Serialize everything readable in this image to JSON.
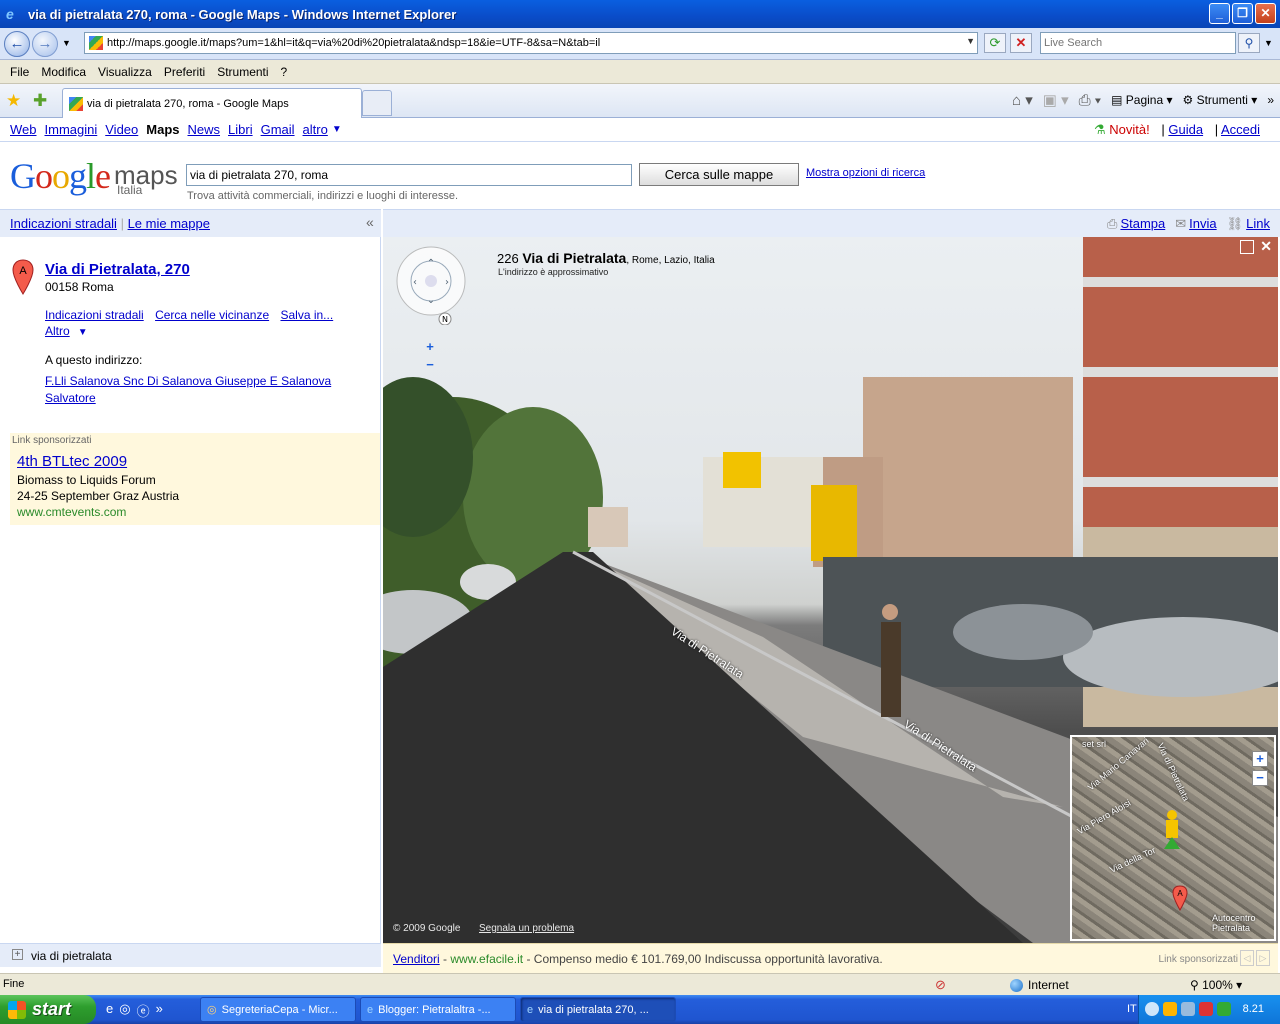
{
  "window": {
    "title": "via di pietralata 270, roma - Google Maps - Windows Internet Explorer"
  },
  "address_bar": {
    "url": "http://maps.google.it/maps?um=1&hl=it&q=via%20di%20pietralata&ndsp=18&ie=UTF-8&sa=N&tab=il",
    "live_search_placeholder": "Live Search"
  },
  "menu": [
    "File",
    "Modifica",
    "Visualizza",
    "Preferiti",
    "Strumenti",
    "?"
  ],
  "tab": {
    "label": "via di pietralata 270, roma - Google Maps"
  },
  "command_bar": {
    "page": "Pagina",
    "tools": "Strumenti"
  },
  "google_bar": {
    "links": [
      "Web",
      "Immagini",
      "Video"
    ],
    "current": "Maps",
    "links2": [
      "News",
      "Libri",
      "Gmail"
    ],
    "more": "altro",
    "novita": "Novità!",
    "guida": "Guida",
    "accedi": "Accedi"
  },
  "logo": {
    "maps": "maps",
    "sub": "Italia"
  },
  "search": {
    "value": "via di pietralata 270, roma",
    "button": "Cerca sulle mappe",
    "advanced": "Mostra opzioni di ricerca",
    "hint": "Trova attività commerciali, indirizzi e luoghi di interesse."
  },
  "subheader": {
    "directions": "Indicazioni stradali",
    "my_maps": "Le mie mappe",
    "print": "Stampa",
    "send": "Invia",
    "link": "Link"
  },
  "result": {
    "title": "Via di Pietralata, 270",
    "address": "00158 Roma",
    "action_directions": "Indicazioni stradali",
    "action_nearby": "Cerca nelle vicinanze",
    "action_save": "Salva in...",
    "action_more": "Altro",
    "at_address": "A questo indirizzo:",
    "business": "F.Lli Salanova Snc Di Salanova Giuseppe E Salanova Salvatore"
  },
  "sponsored": {
    "label": "Link sponsorizzati",
    "title": "4th BTLtec 2009",
    "line1": "Biomass to Liquids Forum",
    "line2": "24-25 September Graz Austria",
    "url": "www.cmtevents.com"
  },
  "bottom_search": {
    "text": "via di pietralata"
  },
  "street_view": {
    "number": "226",
    "street": "Via di Pietralata",
    "locality": ", Rome, Lazio, Italia",
    "approx": "L'indirizzo è approssimativo",
    "credit": "© 2009 Google",
    "report": "Segnala un problema",
    "road_label": "Via di Pietralata",
    "compass_n": "N"
  },
  "minimap": {
    "labels": [
      "set srl",
      "Via Mario Canavari",
      "Via di Pietralata",
      "Via Piero Aloisi",
      "Via della Tor",
      "Autocentro Pietralata"
    ]
  },
  "bottom_ad": {
    "link": "Venditori",
    "url": "www.efacile.it",
    "text": "Compenso medio € 101.769,00 Indiscussa opportunità lavorativa.",
    "label": "Link sponsorizzati"
  },
  "status_bar": {
    "left": "Fine",
    "zone": "Internet",
    "zoom": "100%"
  },
  "taskbar": {
    "start": "start",
    "tasks": [
      "SegreteriaCepa - Micr...",
      "Blogger: Pietralaltra -...",
      "via di pietralata 270, ..."
    ],
    "lang": "IT",
    "clock": "8.21"
  }
}
